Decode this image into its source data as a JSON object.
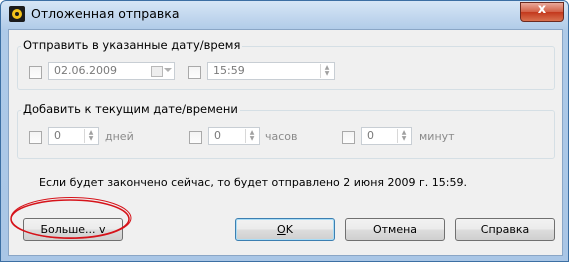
{
  "window": {
    "title": "Отложенная отправка",
    "close_label": "x"
  },
  "send_at_group": {
    "label": "Отправить в указанные дату/время",
    "date_value": "02.06.2009",
    "time_value": "15:59"
  },
  "add_to_current_group": {
    "label": "Добавить к текущим дате/времени",
    "days_value": "0",
    "days_unit": "дней",
    "hours_value": "0",
    "hours_unit": "часов",
    "minutes_value": "0",
    "minutes_unit": "минут"
  },
  "info_text": "Если будет закончено сейчас, то будет отправлено 2 июня 2009 г. 15:59.",
  "buttons": {
    "more": "Больше... v",
    "ok_first": "О",
    "ok_rest": "K",
    "cancel": "Отмена",
    "help": "Справка"
  },
  "colors": {
    "annotation": "#d6131a",
    "title_bar": "#a9c6e6",
    "close_button": "#c3381c"
  }
}
